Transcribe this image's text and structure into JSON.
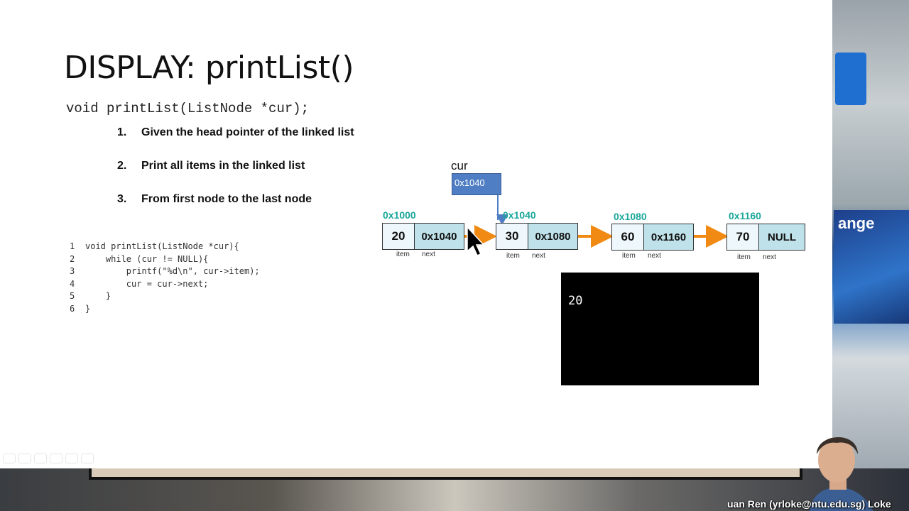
{
  "slide": {
    "title": "DISPLAY: printList()",
    "signature": "void printList(ListNode *cur);",
    "points": [
      {
        "num": "1.",
        "text": "Given the head pointer of the linked list"
      },
      {
        "num": "2.",
        "text": "Print all items in the linked list"
      },
      {
        "num": "3.",
        "text": "From first node to the last node"
      }
    ],
    "code_lines": [
      {
        "n": "1",
        "text": "void printList(ListNode *cur){"
      },
      {
        "n": "2",
        "text": "    while (cur != NULL){"
      },
      {
        "n": "3",
        "text": "        printf(\"%d\\n\", cur->item);"
      },
      {
        "n": "4",
        "text": "        cur = cur->next;"
      },
      {
        "n": "5",
        "text": "    }"
      },
      {
        "n": "6",
        "text": "}"
      }
    ]
  },
  "diagram": {
    "cur_label": "cur",
    "cur_value": "0x1040",
    "item_label": "item",
    "next_label": "next",
    "nodes": [
      {
        "address": "0x1000",
        "item": "20",
        "next": "0x1040"
      },
      {
        "address": "0x1040",
        "item": "30",
        "next": "0x1080"
      },
      {
        "address": "0x1080",
        "item": "60",
        "next": "0x1160"
      },
      {
        "address": "0x1160",
        "item": "70",
        "next": "NULL"
      }
    ],
    "arrow_color": "#f08a12",
    "pointer_color": "#4f7ec4",
    "address_color": "#1aa79a"
  },
  "console": {
    "output": "20"
  },
  "video": {
    "poster_text": "ange",
    "caption": "uan Ren (yrloke@ntu.edu.sg) Loke"
  }
}
